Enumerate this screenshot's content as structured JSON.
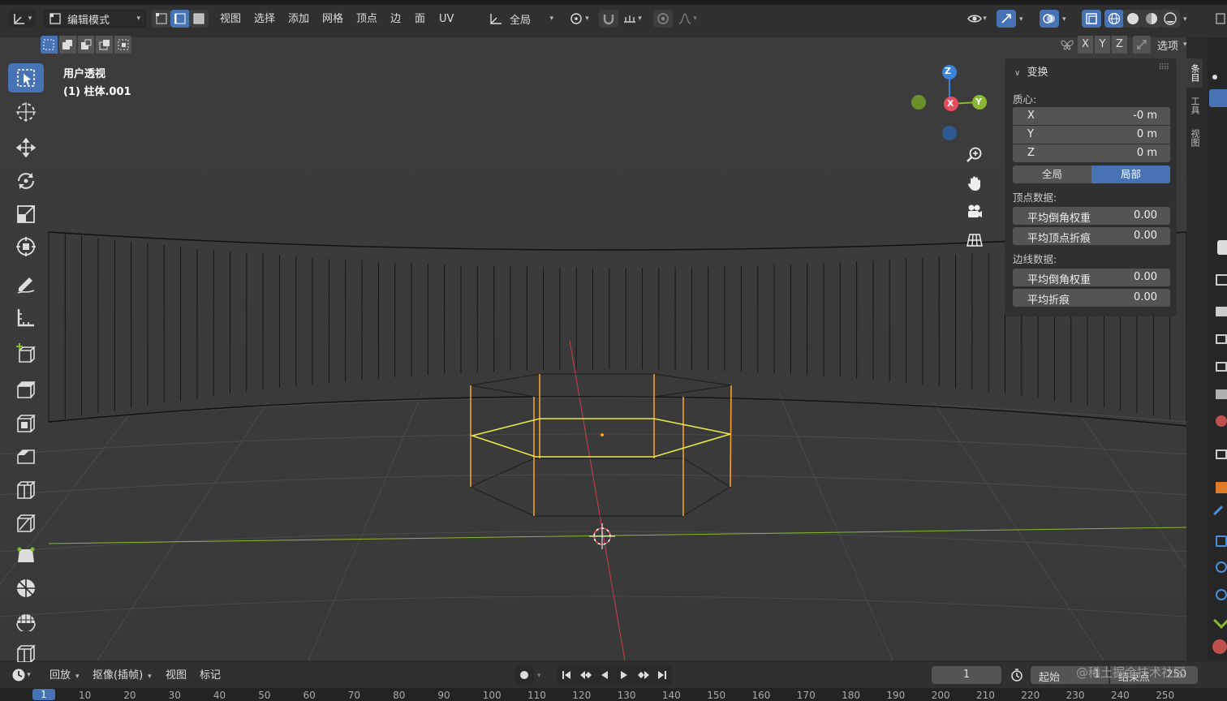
{
  "header": {
    "mode_label": "编辑模式",
    "menus": [
      "视图",
      "选择",
      "添加",
      "网格",
      "顶点",
      "边",
      "面",
      "UV"
    ],
    "orientation": "全局",
    "axes": [
      "X",
      "Y",
      "Z"
    ],
    "options_label": "选项"
  },
  "viewport": {
    "view_name": "用户透视",
    "object_name": "(1) 柱体.001",
    "gizmo": {
      "z": "Z",
      "y": "Y",
      "x": "X"
    }
  },
  "npanel": {
    "section_title": "变换",
    "median_label": "质心:",
    "median": [
      {
        "axis": "X",
        "value": "-0 m"
      },
      {
        "axis": "Y",
        "value": "0 m"
      },
      {
        "axis": "Z",
        "value": "0 m"
      }
    ],
    "space_global": "全局",
    "space_local": "局部",
    "vertex_data_label": "顶点数据:",
    "vertex_data": [
      {
        "label": "平均倒角权重",
        "value": "0.00"
      },
      {
        "label": "平均顶点折痕",
        "value": "0.00"
      }
    ],
    "edge_data_label": "边线数据:",
    "edge_data": [
      {
        "label": "平均倒角权重",
        "value": "0.00"
      },
      {
        "label": "平均折痕",
        "value": "0.00"
      }
    ],
    "tabs": [
      "条目",
      "工具",
      "视图"
    ]
  },
  "timeline": {
    "menus": [
      "回放",
      "抠像(插帧)",
      "视图",
      "标记"
    ],
    "current_frame": "1",
    "start_label": "起始",
    "start_value": "1",
    "end_label": "结束点",
    "end_value": "250",
    "ticks": [
      "1",
      "10",
      "20",
      "30",
      "40",
      "50",
      "60",
      "70",
      "80",
      "90",
      "100",
      "110",
      "120",
      "130",
      "140",
      "150",
      "160",
      "170",
      "180",
      "190",
      "200",
      "210",
      "220",
      "230",
      "240",
      "250"
    ]
  },
  "watermark": "@稀土掘金技术社区",
  "colors": {
    "accent": "#4772b3",
    "selected_edge": "#f2a030",
    "active_edge": "#e8e84a",
    "axis_x": "#e84a5f",
    "axis_y": "#8ab833",
    "axis_z": "#3b82d9"
  }
}
